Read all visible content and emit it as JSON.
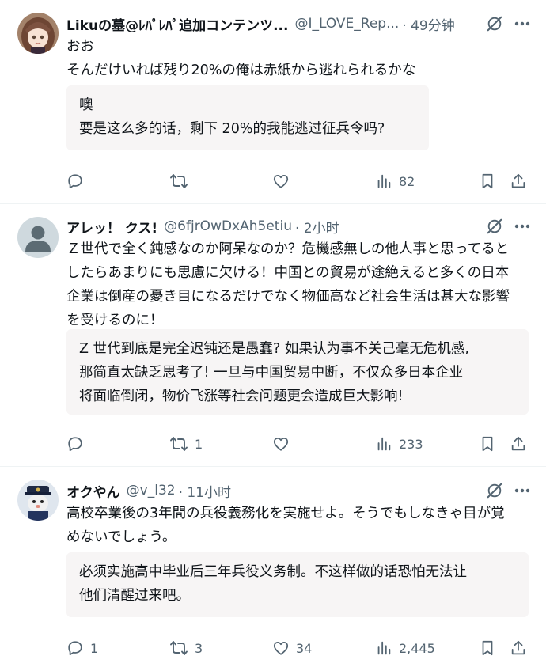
{
  "colors": {
    "text": "#0f1419",
    "secondary": "#536471",
    "translation_bg": "#f7f5f5",
    "divider": "#eff3f4"
  },
  "posts": [
    {
      "name": "Likuの墓@ﾚﾊﾟﾚﾊﾟ追加コンテンツ...",
      "handle": "@I_LOVE_Rep...",
      "time": "· 49分钟",
      "avatar": "anime-girl-avatar",
      "text": [
        "おお",
        "そんだけいれば残り20%の俺は赤紙から逃れられるかな"
      ],
      "translation": [
        "噢",
        "要是这么多的话，剩下 20%的我能逃过征兵令吗?"
      ],
      "actions": {
        "reply": "",
        "repost": "",
        "like": "",
        "views": "82"
      }
    },
    {
      "name": "アレッ！ クス!",
      "handle": "@6fjrOwDxAh5etiu",
      "time": "· 2小时",
      "avatar": "default-person-avatar",
      "text": [
        "Ｚ世代で全く鈍感なのか阿呆なのか？危機感無しの他人事と思ってると",
        "したらあまりにも思慮に欠ける！中国との貿易が途絶えると多くの日本",
        "企業は倒産の憂き目になるだけでなく物価高など社会生活は甚大な影響",
        "を受けるのに！"
      ],
      "translation": [
        "Z 世代到底是完全迟钝还是愚蠢? 如果认为事不关己毫无危机感,",
        "那简直太缺乏思考了! 一旦与中国贸易中断，不仅众多日本企业",
        "将面临倒闭，物价飞涨等社会问题更会造成巨大影响!"
      ],
      "actions": {
        "reply": "",
        "repost": "1",
        "like": "",
        "views": "233"
      }
    },
    {
      "name": "オクやん",
      "handle": "@v_l32",
      "time": "· 11小时",
      "avatar": "police-mascot-avatar",
      "text": [
        "高校卒業後の3年間の兵役義務化を実施せよ。そうでもしなきゃ目が覚",
        "めないでしょう。"
      ],
      "translation": [
        "必须实施高中毕业后三年兵役义务制。不这样做的话恐怕无法让",
        "他们清醒过来吧。"
      ],
      "actions": {
        "reply": "1",
        "repost": "3",
        "like": "34",
        "views": "2,445"
      }
    }
  ]
}
